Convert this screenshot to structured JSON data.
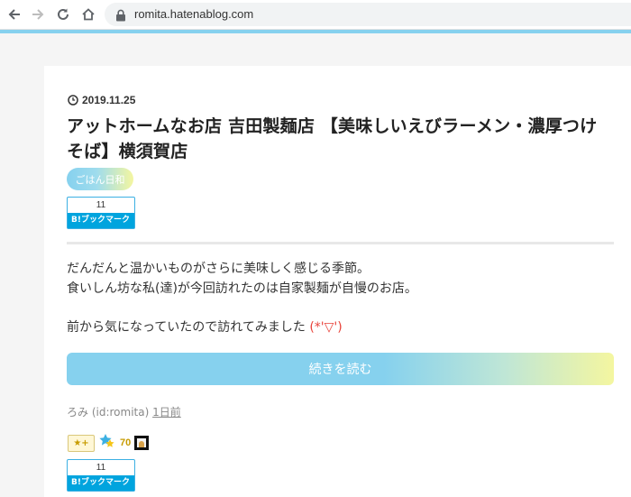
{
  "browser": {
    "url": "romita.hatenablog.com",
    "icons": [
      "back-arrow-icon",
      "forward-arrow-icon",
      "reload-icon",
      "home-icon",
      "lock-icon"
    ]
  },
  "colors": {
    "accent": "#86d1ee",
    "gradient_end": "#f4f6a0",
    "hatena_blue": "#00a4de",
    "kaomoji_red": "#e8423a"
  },
  "article": {
    "date": "2019.11.25",
    "title": "アットホームなお店 吉田製麺店 【美味しいえびラーメン・濃厚つけそば】横須賀店",
    "category": "ごはん日和",
    "bookmark_top": {
      "count": "11",
      "label": "B!ブックマーク"
    },
    "body": {
      "line1": "だんだんと温かいものがさらに美味しく感じる季節。",
      "line2": "食いしん坊な私(達)が今回訪れたのは自家製麺が自慢のお店。",
      "line3": "前から気になっていたので訪れてみました",
      "kaomoji": "(*'▽')"
    },
    "read_more": "続きを読む",
    "author": "ろみ (id:romita)",
    "time_ago": "1日前",
    "stars": {
      "add_label": "★+",
      "count": "70"
    },
    "bookmark_bottom": {
      "count": "11",
      "label": "B!ブックマーク"
    }
  }
}
